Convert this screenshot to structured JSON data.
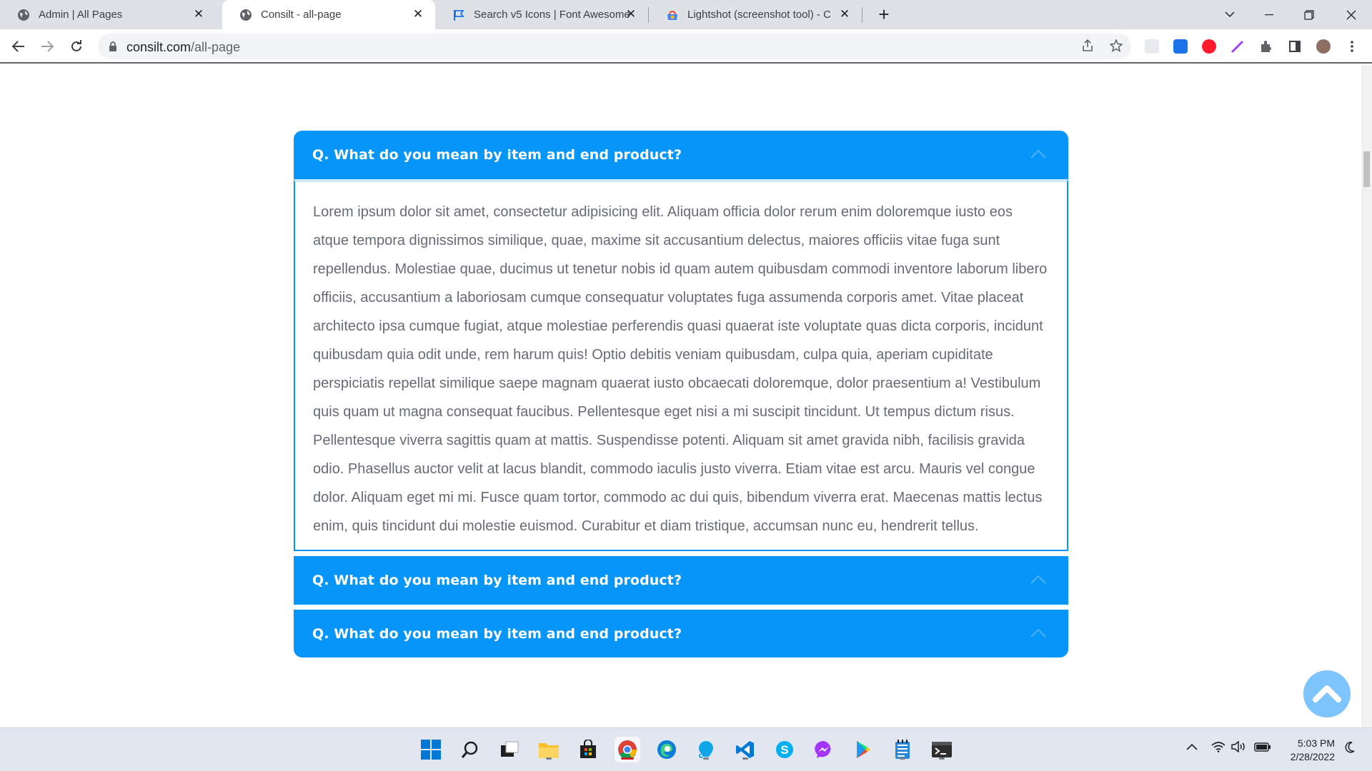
{
  "browser": {
    "tabs": [
      {
        "title": "Admin | All Pages",
        "active": false
      },
      {
        "title": "Consilt - all-page",
        "active": true
      },
      {
        "title": "Search v5 Icons | Font Awesome",
        "active": false
      },
      {
        "title": "Lightshot (screenshot tool) - Chr",
        "active": false
      }
    ],
    "new_tab_label": "+",
    "url_host": "consilt.com",
    "url_path": "/all-page"
  },
  "faq": {
    "items": [
      {
        "question": "Q. What do you mean by item and end product?",
        "expanded": true,
        "answer": "Lorem ipsum dolor sit amet, consectetur adipisicing elit. Aliquam officia dolor rerum enim doloremque iusto eos atque tempora dignissimos similique, quae, maxime sit accusantium delectus, maiores officiis vitae fuga sunt repellendus. Molestiae quae, ducimus ut tenetur nobis id quam autem quibusdam commodi inventore laborum libero officiis, accusantium a laboriosam cumque consequatur voluptates fuga assumenda corporis amet. Vitae placeat architecto ipsa cumque fugiat, atque molestiae perferendis quasi quaerat iste voluptate quas dicta corporis, incidunt quibusdam quia odit unde, rem harum quis! Optio debitis veniam quibusdam, culpa quia, aperiam cupiditate perspiciatis repellat similique saepe magnam quaerat iusto obcaecati doloremque, dolor praesentium a! Vestibulum quis quam ut magna consequat faucibus. Pellentesque eget nisi a mi suscipit tincidunt. Ut tempus dictum risus. Pellentesque viverra sagittis quam at mattis. Suspendisse potenti. Aliquam sit amet gravida nibh, facilisis gravida odio. Phasellus auctor velit at lacus blandit, commodo iaculis justo viverra. Etiam vitae est arcu. Mauris vel congue dolor. Aliquam eget mi mi. Fusce quam tortor, commodo ac dui quis, bibendum viverra erat. Maecenas mattis lectus enim, quis tincidunt dui molestie euismod. Curabitur et diam tristique, accumsan nunc eu, hendrerit tellus."
      },
      {
        "question": "Q. What do you mean by item and end product?",
        "expanded": false
      },
      {
        "question": "Q. What do you mean by item and end product?",
        "expanded": false
      }
    ]
  },
  "colors": {
    "accent": "#0696fa",
    "answer_text": "#666c74",
    "scroll_top_button": "#7cc4fb"
  },
  "taskbar": {
    "clock_time": "5:03 PM",
    "clock_date": "2/28/2022"
  }
}
